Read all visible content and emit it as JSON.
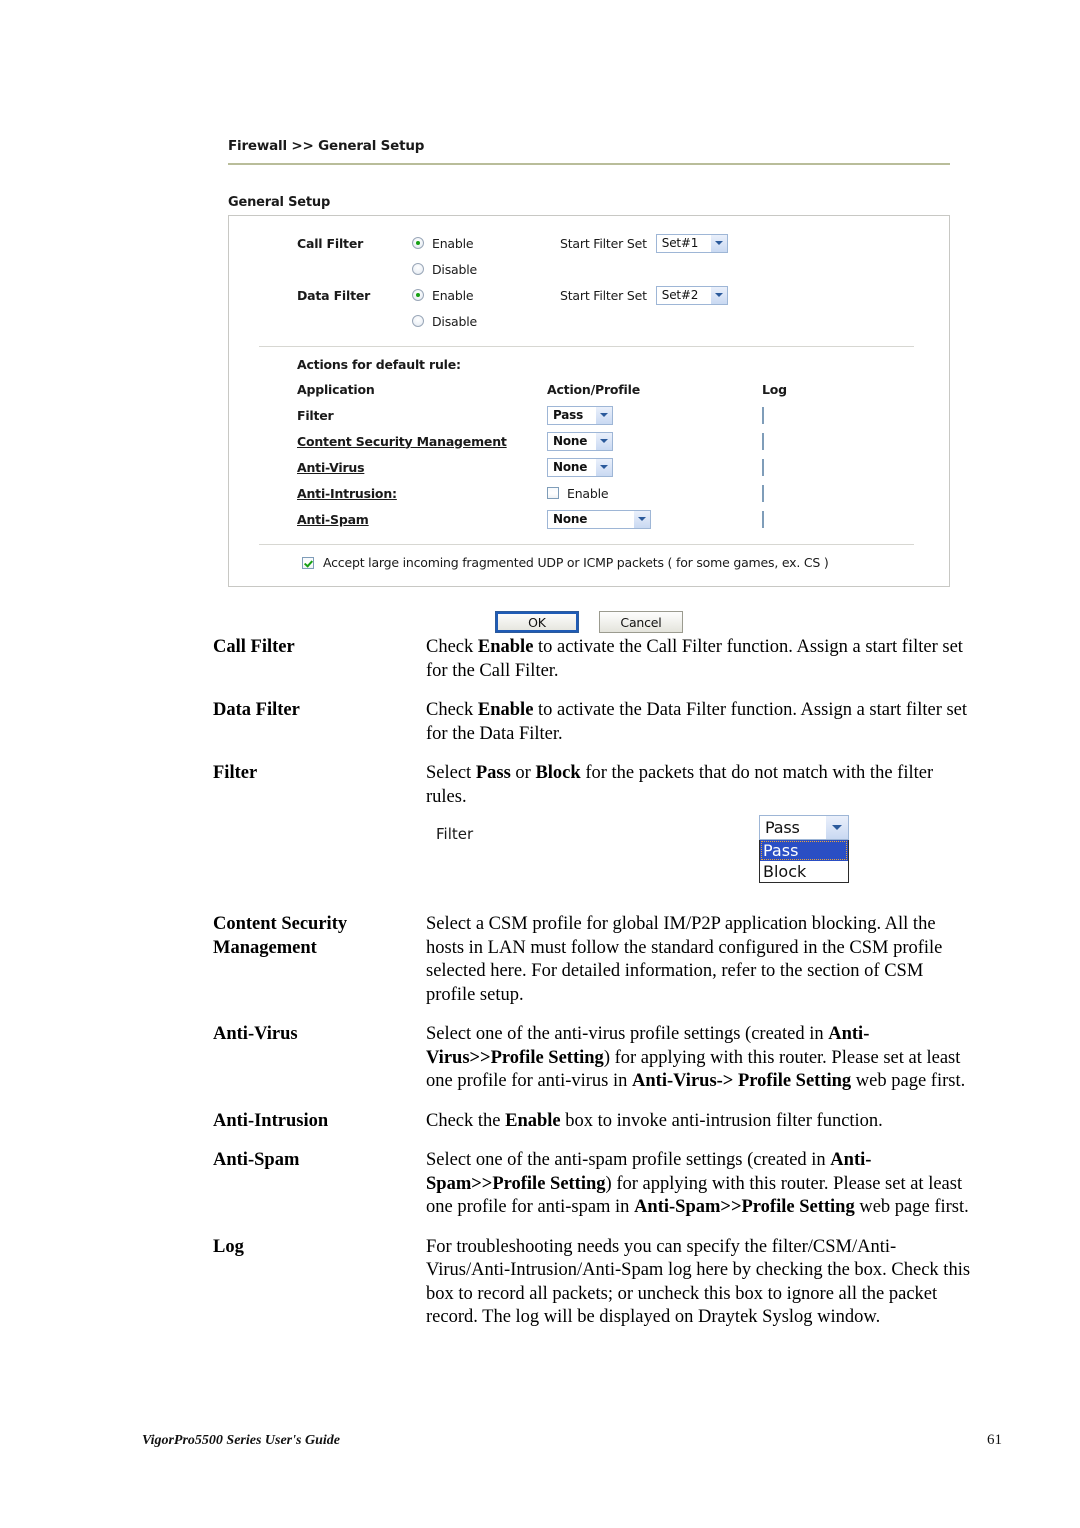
{
  "screenshot": {
    "breadcrumb": "Firewall >> General Setup",
    "section_title": "General Setup",
    "call_filter": {
      "label": "Call Filter",
      "enable_label": "Enable",
      "disable_label": "Disable",
      "enabled": true,
      "start_filter_set_label": "Start Filter Set",
      "start_filter_set_value": "Set#1"
    },
    "data_filter": {
      "label": "Data Filter",
      "enable_label": "Enable",
      "disable_label": "Disable",
      "enabled": true,
      "start_filter_set_label": "Start Filter Set",
      "start_filter_set_value": "Set#2"
    },
    "actions_heading": "Actions for default rule:",
    "columns": {
      "application": "Application",
      "action_profile": "Action/Profile",
      "log": "Log"
    },
    "rows": [
      {
        "application": "Filter",
        "control": "select",
        "value": "Pass",
        "log_checked": false
      },
      {
        "application": "Content Security Management",
        "control": "select",
        "value": "None",
        "log_checked": false
      },
      {
        "application": "Anti-Virus",
        "control": "select",
        "value": "None",
        "log_checked": false
      },
      {
        "application": "Anti-Intrusion:",
        "control": "checkbox",
        "value": "Enable",
        "log_checked": false
      },
      {
        "application": "Anti-Spam",
        "control": "select",
        "value": "None",
        "log_checked": false
      }
    ],
    "accept_fragmented": {
      "checked": true,
      "label": "Accept large incoming fragmented UDP or ICMP packets ( for some games, ex. CS )"
    },
    "buttons": {
      "ok": "OK",
      "cancel": "Cancel"
    },
    "colors": {
      "radio_dot": "#17a014",
      "check_mark": "#17a014",
      "select_border": "#9eb6d6",
      "rule_line": "#b9bd9a",
      "highlight": "#2a4ec4"
    }
  },
  "descriptions": [
    {
      "term": "Call Filter",
      "parts": [
        {
          "t": "Check ",
          "b": false
        },
        {
          "t": "Enable",
          "b": true
        },
        {
          "t": " to activate the Call Filter function. Assign a start filter set for the Call Filter.",
          "b": false
        }
      ]
    },
    {
      "term": "Data Filter",
      "parts": [
        {
          "t": "Check ",
          "b": false
        },
        {
          "t": "Enable",
          "b": true
        },
        {
          "t": " to activate the Data Filter function. Assign a start filter set for the Data Filter.",
          "b": false
        }
      ]
    },
    {
      "term": "Filter",
      "parts": [
        {
          "t": "Select ",
          "b": false
        },
        {
          "t": "Pass",
          "b": true
        },
        {
          "t": " or ",
          "b": false
        },
        {
          "t": "Block",
          "b": true
        },
        {
          "t": " for the packets that do not match with the filter rules.",
          "b": false
        }
      ],
      "illustration": {
        "label": "Filter",
        "selected": "Pass",
        "options": [
          "Pass",
          "Block"
        ]
      }
    },
    {
      "term": "Content Security Management",
      "parts": [
        {
          "t": "Select a CSM profile for global IM/P2P application blocking. All the hosts in LAN must follow the standard configured in the CSM profile selected here. For detailed information, refer to the section of CSM profile setup.",
          "b": false
        }
      ]
    },
    {
      "term": "Anti-Virus",
      "parts": [
        {
          "t": "Select one of the anti-virus profile settings (created in ",
          "b": false
        },
        {
          "t": "Anti-Virus>>Profile Setting",
          "b": true
        },
        {
          "t": ") for applying with this router. Please set at least one profile for anti-virus in ",
          "b": false
        },
        {
          "t": "Anti-Virus-> Profile Setting",
          "b": true
        },
        {
          "t": " web page first.",
          "b": false
        }
      ]
    },
    {
      "term": "Anti-Intrusion",
      "parts": [
        {
          "t": "Check the ",
          "b": false
        },
        {
          "t": "Enable",
          "b": true
        },
        {
          "t": " box to invoke anti-intrusion filter function.",
          "b": false
        }
      ]
    },
    {
      "term": "Anti-Spam",
      "parts": [
        {
          "t": "Select one of the anti-spam profile settings (created in ",
          "b": false
        },
        {
          "t": "Anti-Spam>>Profile Setting",
          "b": true
        },
        {
          "t": ") for applying with this router. Please set at least one profile for anti-spam in ",
          "b": false
        },
        {
          "t": "Anti-Spam>>Profile Setting",
          "b": true
        },
        {
          "t": " web page first.",
          "b": false
        }
      ]
    },
    {
      "term": "Log",
      "parts": [
        {
          "t": "For troubleshooting needs you can specify the filter/CSM/Anti-Virus/Anti-Intrusion/Anti-Spam log here by checking the box. Check this box to record all packets; or uncheck this box to ignore all the packet record. The log will be displayed on Draytek Syslog window.",
          "b": false
        }
      ]
    }
  ],
  "footer": {
    "left": "VigorPro5500 Series User's Guide",
    "page_number": "61"
  }
}
